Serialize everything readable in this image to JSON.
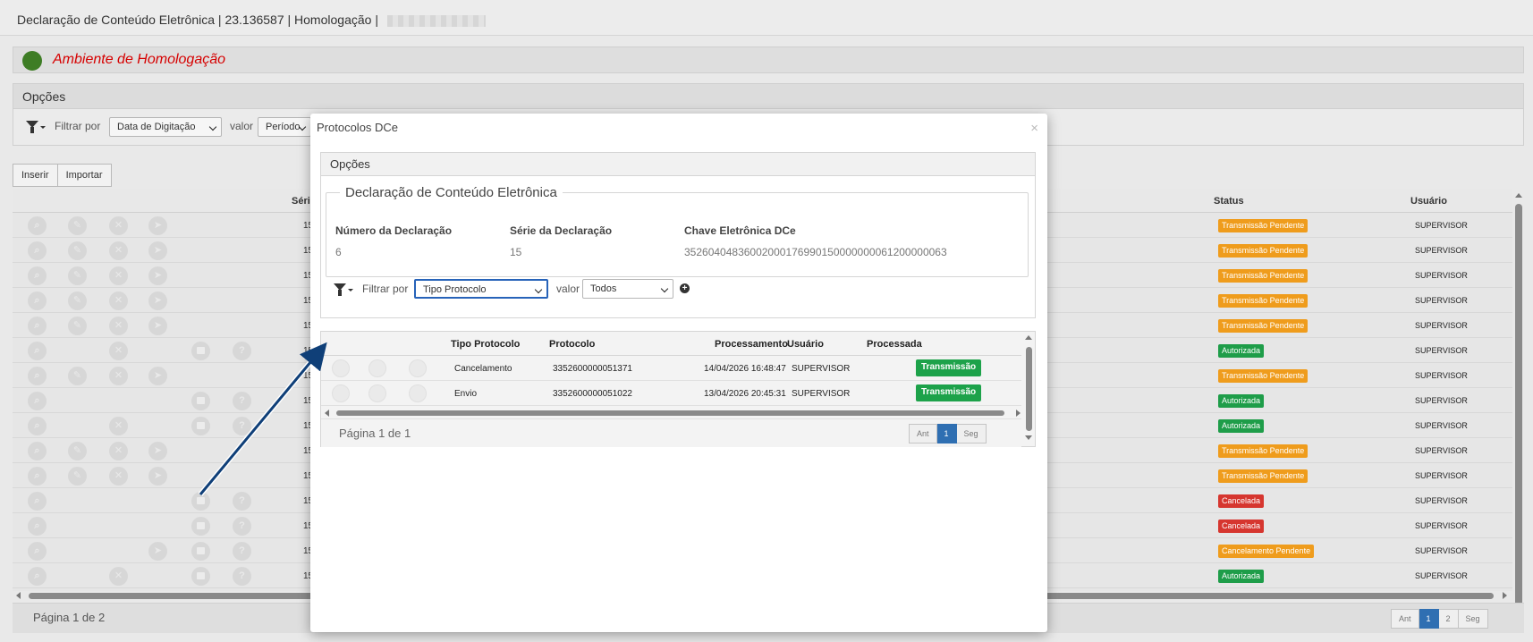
{
  "header": {
    "title": "Declaração de Conteúdo Eletrônica | 23.136587 | Homologação | "
  },
  "environment": {
    "label": "Ambiente de Homologação",
    "color": "#3e7d25"
  },
  "options": {
    "title": "Opções",
    "filter_label": "Filtrar por",
    "filter_value": "Data de Digitação",
    "value_label": "valor",
    "value_value": "Período"
  },
  "toolbar": {
    "insert_label": "Inserir",
    "import_label": "Importar"
  },
  "table": {
    "columns": {
      "serie": "Séri",
      "status": "Status",
      "usuario": "Usuário"
    },
    "rows": [
      {
        "serie": "15",
        "status": "Transmissão Pendente",
        "user": "SUPERVISOR"
      },
      {
        "serie": "15",
        "status": "Transmissão Pendente",
        "user": "SUPERVISOR"
      },
      {
        "serie": "15",
        "status": "Transmissão Pendente",
        "user": "SUPERVISOR"
      },
      {
        "serie": "15",
        "status": "Transmissão Pendente",
        "user": "SUPERVISOR"
      },
      {
        "serie": "15",
        "status": "Transmissão Pendente",
        "user": "SUPERVISOR"
      },
      {
        "serie": "15",
        "status": "Autorizada",
        "user": "SUPERVISOR"
      },
      {
        "serie": "15",
        "status": "Transmissão Pendente",
        "user": "SUPERVISOR"
      },
      {
        "serie": "15",
        "status": "Autorizada",
        "user": "SUPERVISOR"
      },
      {
        "serie": "15",
        "status": "Autorizada",
        "user": "SUPERVISOR"
      },
      {
        "serie": "15",
        "status": "Transmissão Pendente",
        "user": "SUPERVISOR"
      },
      {
        "serie": "15",
        "status": "Transmissão Pendente",
        "user": "SUPERVISOR"
      },
      {
        "serie": "15",
        "status": "Cancelada",
        "user": "SUPERVISOR"
      },
      {
        "serie": "15",
        "status": "Cancelada",
        "user": "SUPERVISOR"
      },
      {
        "serie": "15",
        "status": "Cancelamento Pendente",
        "user": "SUPERVISOR"
      },
      {
        "serie": "15",
        "status": "Autorizada",
        "user": "SUPERVISOR"
      }
    ]
  },
  "footer": {
    "page_text": "Página 1 de 2",
    "pager": [
      "Ant",
      "1",
      "2",
      "Seg"
    ]
  },
  "modal": {
    "title": "Protocolos DCe",
    "close": "×",
    "options_title": "Opções",
    "legend": "Declaração de Conteúdo Eletrônica",
    "fields": {
      "numero_label": "Número da Declaração",
      "numero_value": "6",
      "serie_label": "Série da Declaração",
      "serie_value": "15",
      "chave_label": "Chave Eletrônica DCe",
      "chave_value": "35260404836002000176990150000000061200000063"
    },
    "filter_label": "Filtrar por",
    "filter_value": "Tipo Protocolo",
    "value_label": "valor",
    "value_value": "Todos",
    "columns": {
      "tipo": "Tipo Protocolo",
      "protocolo": "Protocolo",
      "processamento": "Processamento",
      "usuario": "Usuário",
      "processada": "Processada"
    },
    "rows": [
      {
        "tipo": "Cancelamento",
        "protocolo": "3352600000051371",
        "processamento": "14/04/2026 16:48:47",
        "usuario": "SUPERVISOR",
        "processada": "Transmissão"
      },
      {
        "tipo": "Envio",
        "protocolo": "3352600000051022",
        "processamento": "13/04/2026 20:45:31",
        "usuario": "SUPERVISOR",
        "processada": "Transmissão"
      }
    ],
    "page_text": "Página 1 de 1",
    "pager": [
      "Ant",
      "1",
      "Seg"
    ]
  },
  "colors": {
    "pending": "#ef9c1c",
    "authorized": "#1e9d49",
    "cancelled": "#d6362f",
    "accent": "#2f6fb2",
    "env_text": "#d60000"
  }
}
